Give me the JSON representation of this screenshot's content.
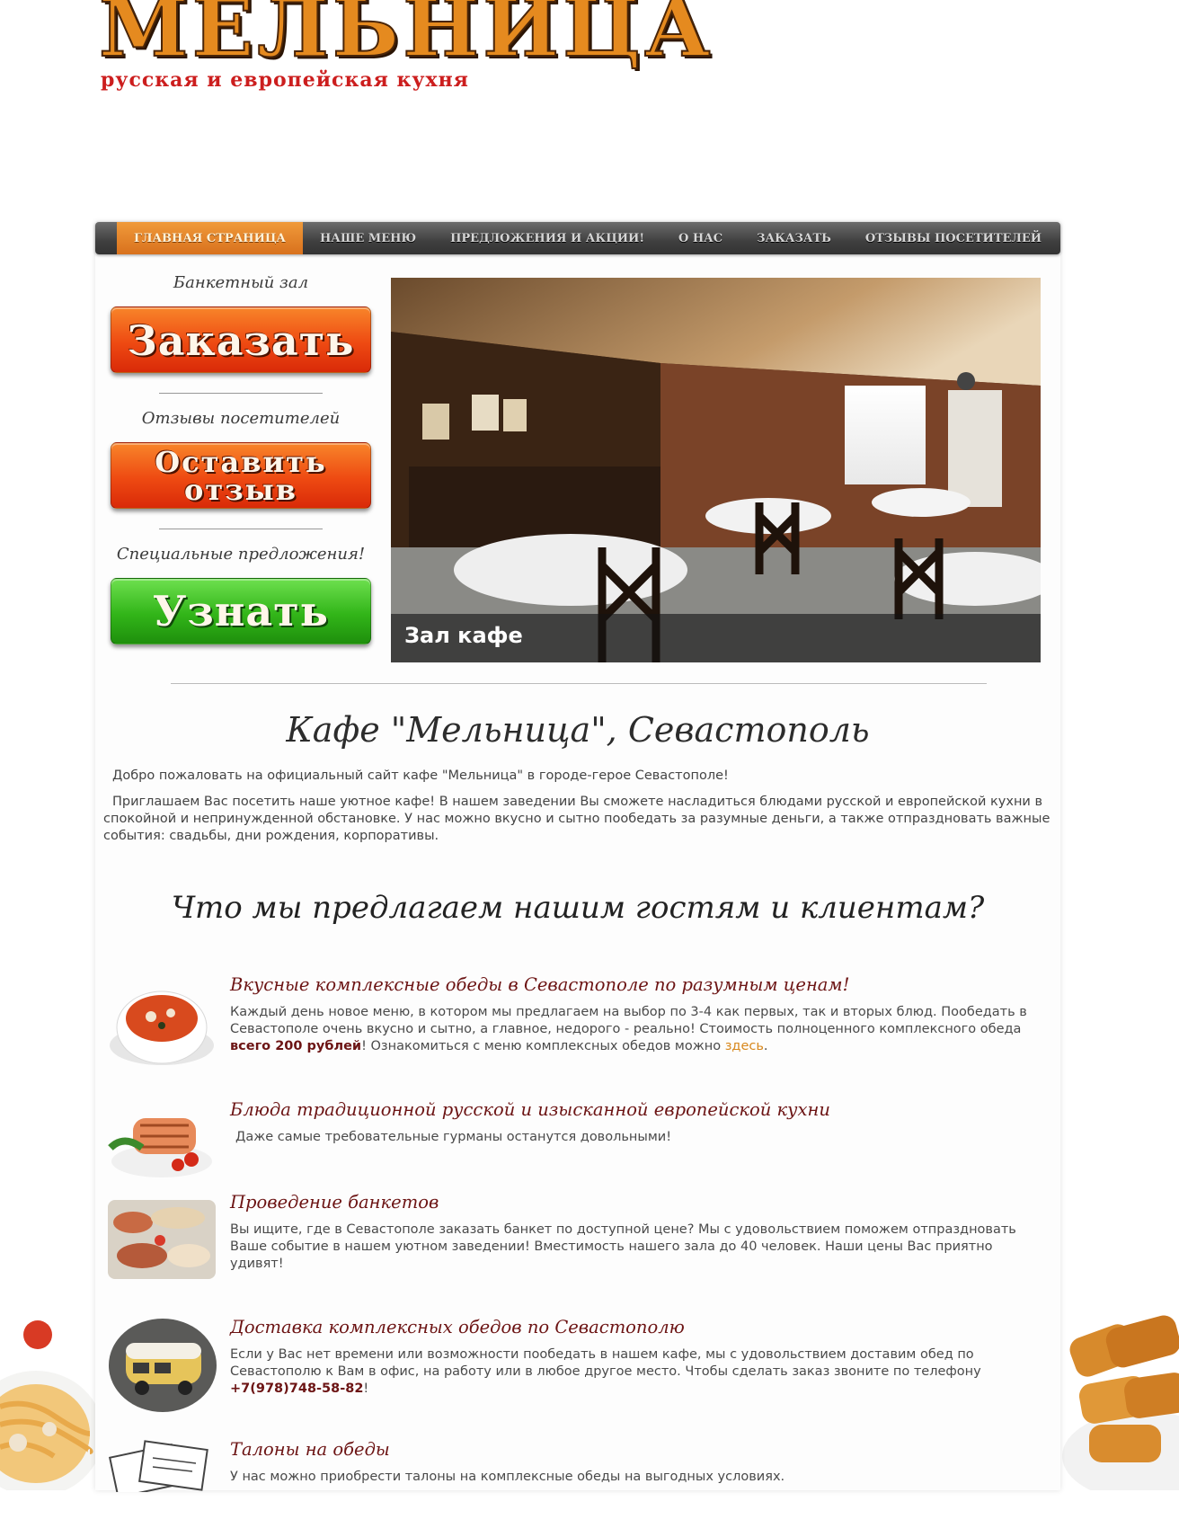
{
  "logo": {
    "title": "МЕЛЬНИЦА",
    "subtitle": "русская и европейская кухня"
  },
  "nav": {
    "items": [
      {
        "label": "Главная страница",
        "active": true
      },
      {
        "label": "Наше меню",
        "active": false
      },
      {
        "label": "Предложения и акции!",
        "active": false
      },
      {
        "label": "О нас",
        "active": false
      },
      {
        "label": "Заказать",
        "active": false
      },
      {
        "label": "Отзывы посетителей",
        "active": false
      }
    ]
  },
  "sidebar": {
    "blocks": [
      {
        "caption": "Банкетный зал",
        "button": "Заказать",
        "color": "#ee4a12"
      },
      {
        "caption": "Отзывы посетителей",
        "button_line1": "Оставить",
        "button_line2": "отзыв",
        "color": "#ee4a12"
      },
      {
        "caption": "Специальные предложения!",
        "button": "Узнать",
        "color": "#32b519"
      }
    ]
  },
  "slider": {
    "caption": "Зал кафе"
  },
  "main": {
    "title": "Кафе \"Мельница\", Севастополь",
    "intro1": "Добро пожаловать на официальный сайт кафе \"Мельница\" в городе-герое Севастополе!",
    "intro2": "Приглашаем Вас посетить наше уютное кафе! В нашем заведении Вы сможете насладиться блюдами русской и европейской кухни в спокойной и непринужденной обстановке. У нас можно вкусно и сытно пообедать за разумные деньги, а также отпраздновать важные события: свадьбы, дни рождения, корпоративы.",
    "offer_title": "Что мы предлагаем нашим гостям и клиентам?"
  },
  "features": [
    {
      "icon": "soup-bowl-icon",
      "title": "Вкусные комплексные обеды в Севастополе по разумным ценам!",
      "text_a": "Каждый день новое меню, в котором мы предлагаем на выбор по 3-4 как первых, так и вторых блюд. Пообедать в Севастополе очень вкусно и сытно, а главное, недорого - реально! Стоимость полноценного комплексного обеда ",
      "text_bold": "всего 200 рублей",
      "text_b": "! Ознакомиться с меню комплексных обедов можно ",
      "link": "здесь",
      "text_c": "."
    },
    {
      "icon": "grilled-fish-icon",
      "title": "Блюда традиционной русской и изысканной европейской кухни",
      "text": "Даже самые требовательные гурманы останутся довольными!"
    },
    {
      "icon": "banquet-platter-icon",
      "title": "Проведение банкетов",
      "text": "Вы ищите, где в Севастополе заказать банкет по доступной цене? Мы с удовольствием поможем отпраздновать Ваше событие в нашем уютном заведении! Вместимость нашего зала до 40 человек. Наши цены Вас приятно удивят!"
    },
    {
      "icon": "delivery-van-icon",
      "title": "Доставка комплексных обедов по Севастополю",
      "text_a": "Если у Вас нет времени или возможности пообедать в нашем кафе, мы с удовольствием доставим обед по Севастополю к Вам в офис, на работу или в любое другое место. Чтобы сделать заказ звоните по телефону ",
      "text_bold": "+7(978)748-58-82",
      "text_b": "!"
    },
    {
      "icon": "meal-coupons-icon",
      "title": "Талоны на обеды",
      "text": "У нас можно приобрести талоны на комплексные обеды на выгодных условиях."
    }
  ],
  "colors": {
    "accent_orange": "#d8711d",
    "title_red": "#6c1414",
    "link": "#d8881d",
    "nav_bg": "#3f3f3f"
  }
}
